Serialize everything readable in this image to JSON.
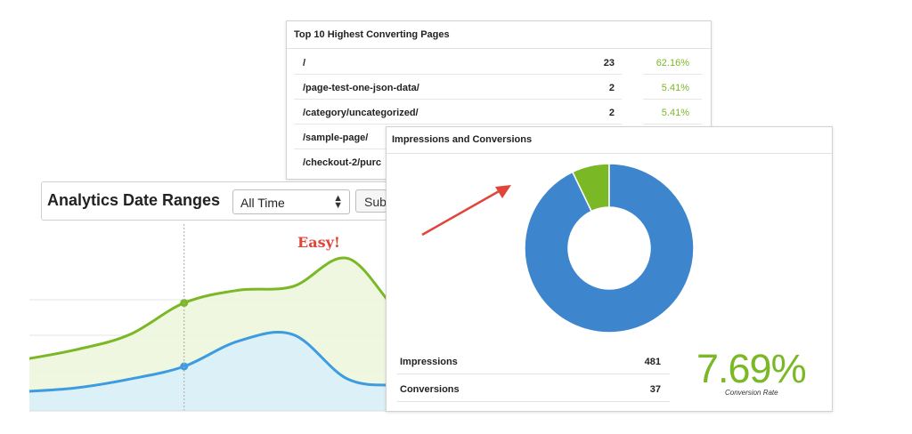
{
  "top_pages": {
    "title": "Top 10 Highest Converting Pages",
    "rows": [
      {
        "path": "/",
        "count": "23",
        "pct": "62.16%"
      },
      {
        "path": "/page-test-one-json-data/",
        "count": "2",
        "pct": "5.41%"
      },
      {
        "path": "/category/uncategorized/",
        "count": "2",
        "pct": "5.41%"
      },
      {
        "path": "/sample-page/",
        "count": "",
        "pct": ""
      },
      {
        "path": "/checkout-2/purc",
        "count": "",
        "pct": ""
      }
    ]
  },
  "date_ranges": {
    "title": "Analytics Date Ranges",
    "selected": "All Time",
    "submit_label": "Sub"
  },
  "annotation": "Easy!",
  "impressions": {
    "title": "Impressions and Conversions",
    "rows": [
      {
        "label": "Impressions",
        "value": "481"
      },
      {
        "label": "Conversions",
        "value": "37"
      }
    ],
    "rate": "7.69%",
    "rate_label": "Conversion Rate"
  },
  "chart_data": [
    {
      "type": "pie",
      "donut": true,
      "labels": [
        "Impressions",
        "Conversions"
      ],
      "values": [
        481,
        37
      ],
      "colors": [
        "#3d85cc",
        "#7ab826"
      ]
    },
    {
      "type": "area",
      "x": [
        0,
        1,
        2,
        3,
        4,
        5,
        6,
        7,
        8
      ],
      "series": [
        {
          "values": [
            40,
            48,
            60,
            85,
            95,
            98,
            120,
            75,
            55
          ],
          "color": "#7ab826"
        },
        {
          "values": [
            15,
            18,
            25,
            35,
            55,
            60,
            25,
            20,
            18
          ],
          "color": "#3d9be0"
        }
      ],
      "ylim": [
        0,
        140
      ],
      "grid": true
    }
  ],
  "colors": {
    "accent_green": "#7ab826",
    "accent_blue": "#3d85cc",
    "arrow_red": "#e0453a"
  }
}
